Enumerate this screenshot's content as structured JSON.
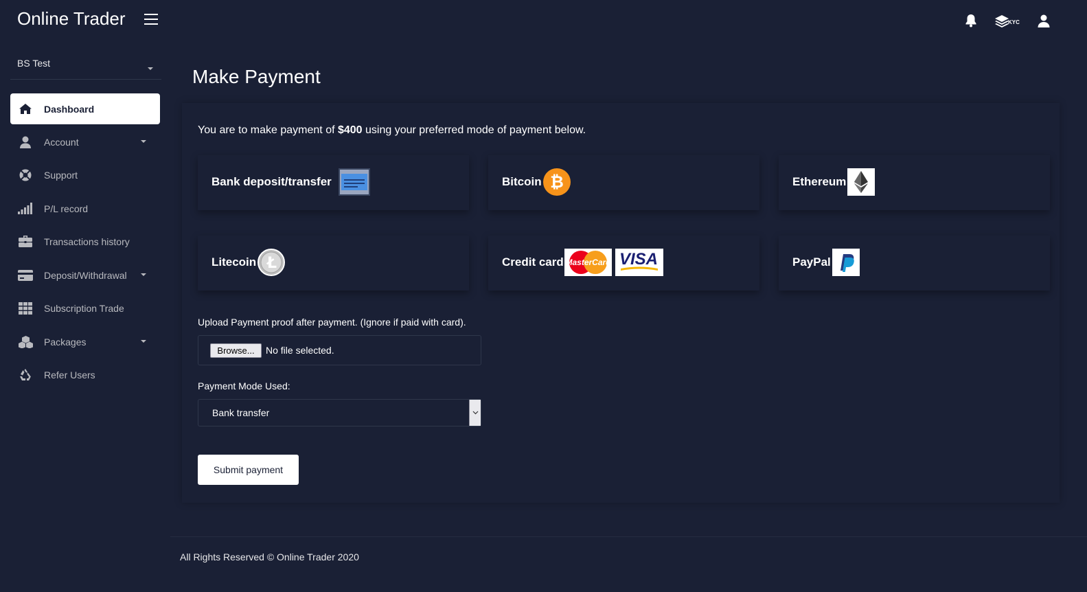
{
  "app": {
    "brand": "Online Trader"
  },
  "header": {
    "kyc_label": "KYC"
  },
  "sidebar": {
    "user_name": "BS Test",
    "items": [
      {
        "label": "Dashboard",
        "icon": "home-icon",
        "active": true,
        "caret": false
      },
      {
        "label": "Account",
        "icon": "user-icon",
        "caret": true
      },
      {
        "label": "Support",
        "icon": "lifebuoy-icon",
        "caret": false
      },
      {
        "label": "P/L record",
        "icon": "signal-bars-icon",
        "caret": false
      },
      {
        "label": "Transactions history",
        "icon": "briefcase-icon",
        "caret": false
      },
      {
        "label": "Deposit/Withdrawal",
        "icon": "credit-card-icon",
        "caret": true
      },
      {
        "label": "Subscription Trade",
        "icon": "grid-icon",
        "caret": false
      },
      {
        "label": "Packages",
        "icon": "cubes-icon",
        "caret": true
      },
      {
        "label": "Refer Users",
        "icon": "recycle-icon",
        "caret": false
      }
    ]
  },
  "main": {
    "title": "Make Payment",
    "intro_before": "You are to make payment of ",
    "amount": "$400",
    "intro_after": " using your preferred mode of payment below.",
    "methods": [
      {
        "label": "Bank deposit/transfer",
        "logo": "bank-card-logo"
      },
      {
        "label": "Bitcoin",
        "logo": "bitcoin-logo"
      },
      {
        "label": "Ethereum",
        "logo": "ethereum-logo"
      },
      {
        "label": "Litecoin",
        "logo": "litecoin-logo"
      },
      {
        "label": "Credit card",
        "logo": "mastercard-visa-logo",
        "mastercard_text": "MasterCard",
        "visa_text": "VISA"
      },
      {
        "label": "PayPal",
        "logo": "paypal-logo"
      }
    ],
    "upload_label": "Upload Payment proof after payment. (Ignore if paid with card).",
    "browse_label": "Browse...",
    "file_status": "No file selected.",
    "mode_label": "Payment Mode Used:",
    "mode_value": "Bank transfer",
    "submit_label": "Submit payment"
  },
  "footer": {
    "text": "All Rights Reserved © Online Trader 2020"
  },
  "colors": {
    "background": "#1a2035",
    "active_nav": "#ffffff",
    "muted_text": "#b9babf",
    "bitcoin": "#f7931a"
  }
}
